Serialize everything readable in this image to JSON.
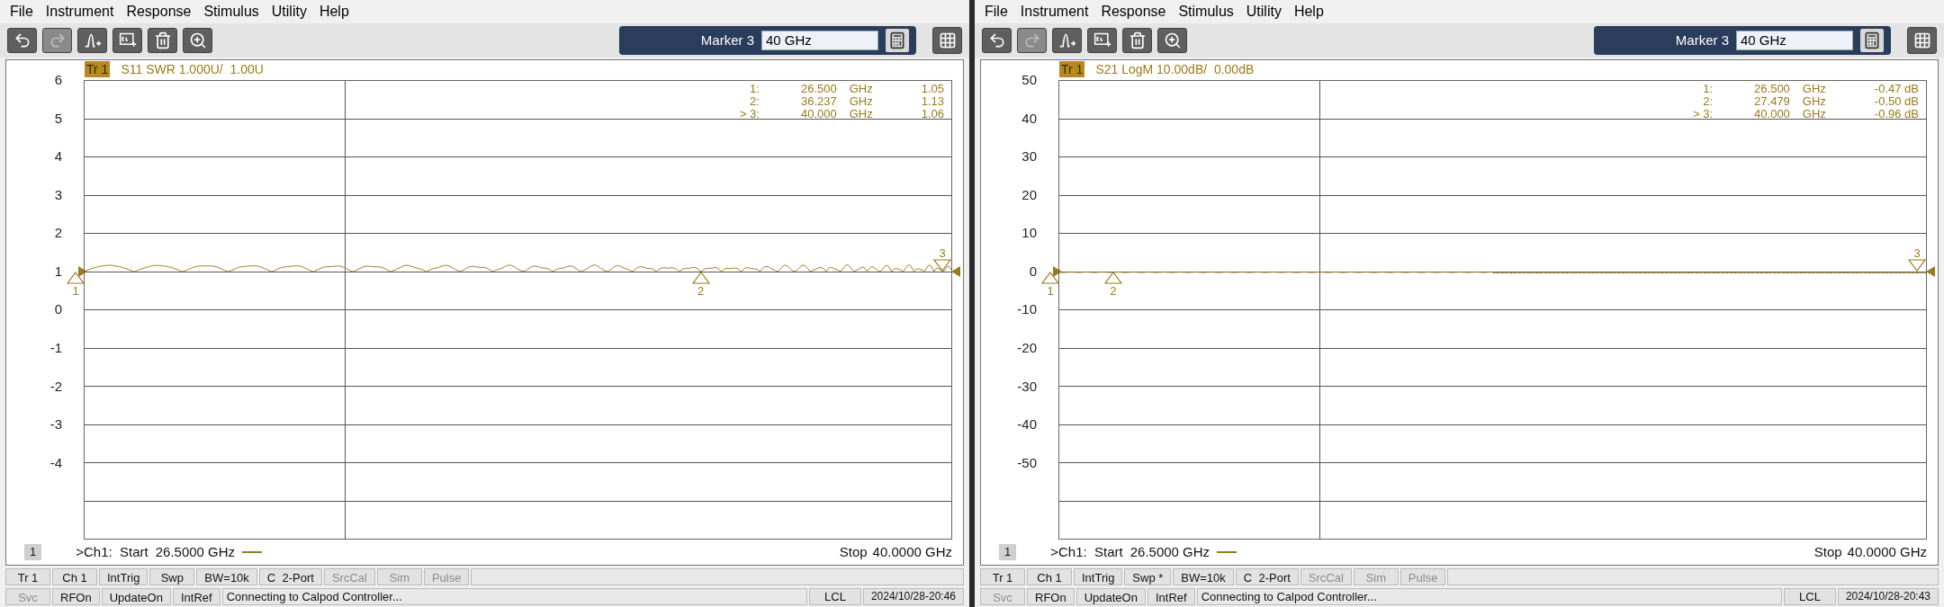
{
  "panels": [
    {
      "menu": [
        "File",
        "Instrument",
        "Response",
        "Stimulus",
        "Utility",
        "Help"
      ],
      "toolbar": [
        {
          "kind": "undo",
          "disabled": false
        },
        {
          "kind": "redo",
          "disabled": true
        },
        {
          "kind": "marker",
          "disabled": false
        },
        {
          "kind": "channel",
          "disabled": false
        },
        {
          "kind": "delete",
          "disabled": false
        },
        {
          "kind": "zoom",
          "disabled": false
        }
      ],
      "marker_control": {
        "label": "Marker 3",
        "value": "40 GHz"
      },
      "trace": {
        "badge": "Tr 1",
        "title": "S11 SWR 1.000U/  1.00U",
        "kind": "swr"
      },
      "y_labels": [
        {
          "text": "6",
          "reference": false
        },
        {
          "text": "5",
          "reference": false
        },
        {
          "text": "4",
          "reference": false
        },
        {
          "text": "3",
          "reference": false
        },
        {
          "text": "2",
          "reference": false
        },
        {
          "text": "1",
          "reference": true
        },
        {
          "text": "0",
          "reference": false
        },
        {
          "text": "-1",
          "reference": false
        },
        {
          "text": "-2",
          "reference": false
        },
        {
          "text": "-3",
          "reference": false
        },
        {
          "text": "-4",
          "reference": false
        }
      ],
      "markers": [
        {
          "label": "1:",
          "freq": "26.500",
          "unit": "GHz",
          "value": "1.05",
          "tag": "1",
          "selected": false
        },
        {
          "label": "2:",
          "freq": "36.237",
          "unit": "GHz",
          "value": "1.13",
          "tag": "2",
          "selected": false
        },
        {
          "label": "> 3:",
          "freq": "40.000",
          "unit": "GHz",
          "value": "1.06",
          "tag": "3",
          "selected": true
        }
      ],
      "channel": {
        "number": "1",
        "start_label": ">Ch1:  Start",
        "start": "26.5000 GHz",
        "stop_label": "Stop",
        "stop": "40.0000 GHz"
      },
      "status_row_1": [
        {
          "label": "Tr 1",
          "disabled": false
        },
        {
          "label": "Ch 1",
          "disabled": false
        },
        {
          "label": "IntTrig",
          "disabled": false
        },
        {
          "label": "Swp",
          "disabled": false
        },
        {
          "label": "BW=10k",
          "disabled": false
        },
        {
          "label": "C  2-Port",
          "disabled": false
        },
        {
          "label": "SrcCal",
          "disabled": true
        },
        {
          "label": "Sim",
          "disabled": true
        },
        {
          "label": "Pulse",
          "disabled": true
        }
      ],
      "status_row_2": [
        {
          "label": "Svc",
          "disabled": true
        },
        {
          "label": "RFOn",
          "disabled": false
        },
        {
          "label": "UpdateOn",
          "disabled": false
        },
        {
          "label": "IntRef",
          "disabled": false
        }
      ],
      "message": "Connecting to Calpod Controller...",
      "lcl": "LCL",
      "datetime": "2024/10/28-20:46"
    },
    {
      "menu": [
        "File",
        "Instrument",
        "Response",
        "Stimulus",
        "Utility",
        "Help"
      ],
      "toolbar": [
        {
          "kind": "undo",
          "disabled": false
        },
        {
          "kind": "redo",
          "disabled": true
        },
        {
          "kind": "marker",
          "disabled": false
        },
        {
          "kind": "channel",
          "disabled": false
        },
        {
          "kind": "delete",
          "disabled": false
        },
        {
          "kind": "zoom",
          "disabled": false
        }
      ],
      "marker_control": {
        "label": "Marker 3",
        "value": "40 GHz"
      },
      "trace": {
        "badge": "Tr 1",
        "title": "S21 LogM 10.00dB/  0.00dB",
        "kind": "logm"
      },
      "y_labels": [
        {
          "text": "50",
          "reference": false
        },
        {
          "text": "40",
          "reference": false
        },
        {
          "text": "30",
          "reference": false
        },
        {
          "text": "20",
          "reference": false
        },
        {
          "text": "10",
          "reference": false
        },
        {
          "text": "0",
          "reference": true
        },
        {
          "text": "-10",
          "reference": false
        },
        {
          "text": "-20",
          "reference": false
        },
        {
          "text": "-30",
          "reference": false
        },
        {
          "text": "-40",
          "reference": false
        },
        {
          "text": "-50",
          "reference": false
        }
      ],
      "markers": [
        {
          "label": "1:",
          "freq": "26.500",
          "unit": "GHz",
          "value": "-0.47 dB",
          "tag": "1",
          "selected": false
        },
        {
          "label": "2:",
          "freq": "27.479",
          "unit": "GHz",
          "value": "-0.50 dB",
          "tag": "2",
          "selected": false
        },
        {
          "label": "> 3:",
          "freq": "40.000",
          "unit": "GHz",
          "value": "-0.96 dB",
          "tag": "3",
          "selected": true
        }
      ],
      "channel": {
        "number": "1",
        "start_label": ">Ch1:  Start",
        "start": "26.5000 GHz",
        "stop_label": "Stop",
        "stop": "40.0000 GHz"
      },
      "status_row_1": [
        {
          "label": "Tr 1",
          "disabled": false
        },
        {
          "label": "Ch 1",
          "disabled": false
        },
        {
          "label": "IntTrig",
          "disabled": false
        },
        {
          "label": "Swp *",
          "disabled": false
        },
        {
          "label": "BW=10k",
          "disabled": false
        },
        {
          "label": "C  2-Port",
          "disabled": false
        },
        {
          "label": "SrcCal",
          "disabled": true
        },
        {
          "label": "Sim",
          "disabled": true
        },
        {
          "label": "Pulse",
          "disabled": true
        }
      ],
      "status_row_2": [
        {
          "label": "Svc",
          "disabled": true
        },
        {
          "label": "RFOn",
          "disabled": false
        },
        {
          "label": "UpdateOn",
          "disabled": false
        },
        {
          "label": "IntRef",
          "disabled": false
        }
      ],
      "message": "Connecting to Calpod Controller...",
      "lcl": "LCL",
      "datetime": "2024/10/28-20:43"
    }
  ]
}
